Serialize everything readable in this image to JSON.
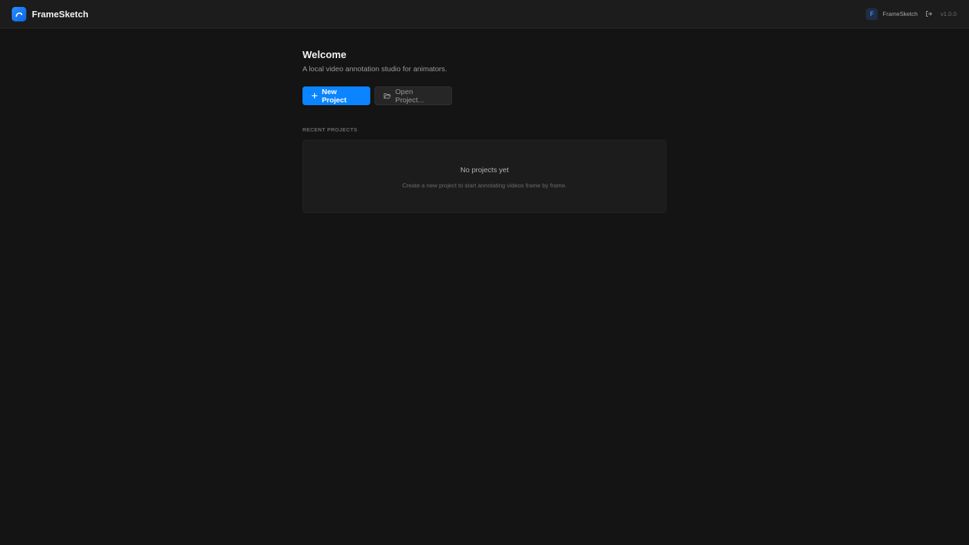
{
  "app": {
    "name": "FrameSketch",
    "logo_icon": "swoosh-icon",
    "accent_color": "#0a84ff"
  },
  "header": {
    "user": {
      "initial": "F",
      "name": "FrameSketch"
    },
    "logout_icon": "logout-icon",
    "version": "v1.0.0"
  },
  "welcome": {
    "title": "Welcome",
    "subtitle": "A local video annotation studio for animators."
  },
  "actions": {
    "new_project_label": "New Project",
    "new_project_icon": "plus-icon",
    "open_project_label": "Open Project...",
    "open_project_icon": "folder-open-icon"
  },
  "recent_projects": {
    "section_label": "RECENT PROJECTS",
    "empty_title": "No projects yet",
    "empty_description": "Create a new project to start annotating videos frame by frame."
  }
}
